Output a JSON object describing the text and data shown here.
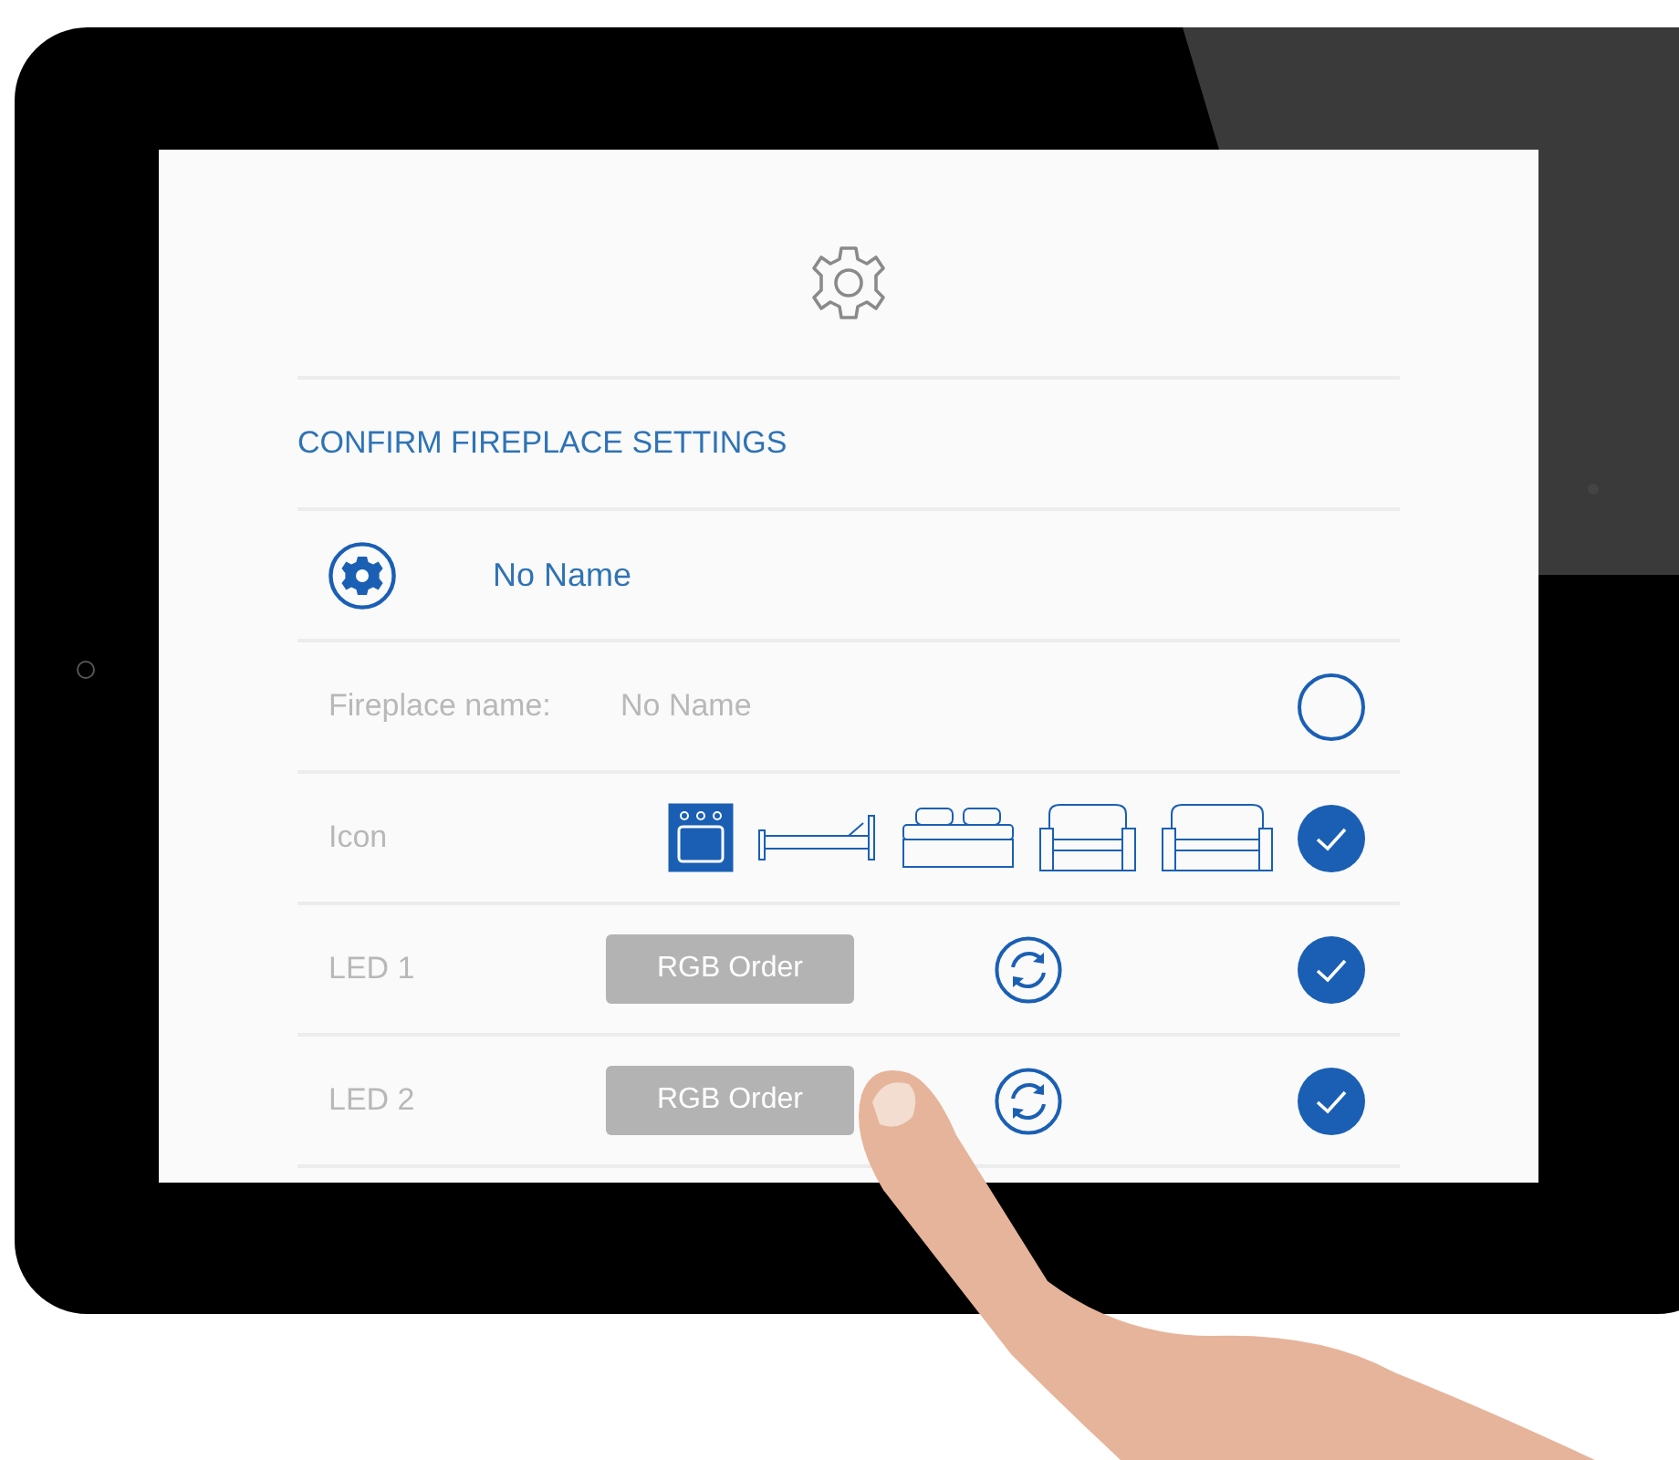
{
  "heading": "CONFIRM FIREPLACE SETTINGS",
  "device": {
    "name": "No Name"
  },
  "name_row": {
    "label": "Fireplace name:",
    "value": "No Name",
    "checked": false
  },
  "icon_row": {
    "label": "Icon",
    "checked": true,
    "options": [
      {
        "kind": "oven",
        "selected": true
      },
      {
        "kind": "bed",
        "selected": false
      },
      {
        "kind": "double-bed",
        "selected": false
      },
      {
        "kind": "armchair",
        "selected": false
      },
      {
        "kind": "sofa",
        "selected": false
      }
    ]
  },
  "leds": [
    {
      "label": "LED 1",
      "button": "RGB Order",
      "checked": true
    },
    {
      "label": "LED 2",
      "button": "RGB Order",
      "checked": true
    }
  ]
}
